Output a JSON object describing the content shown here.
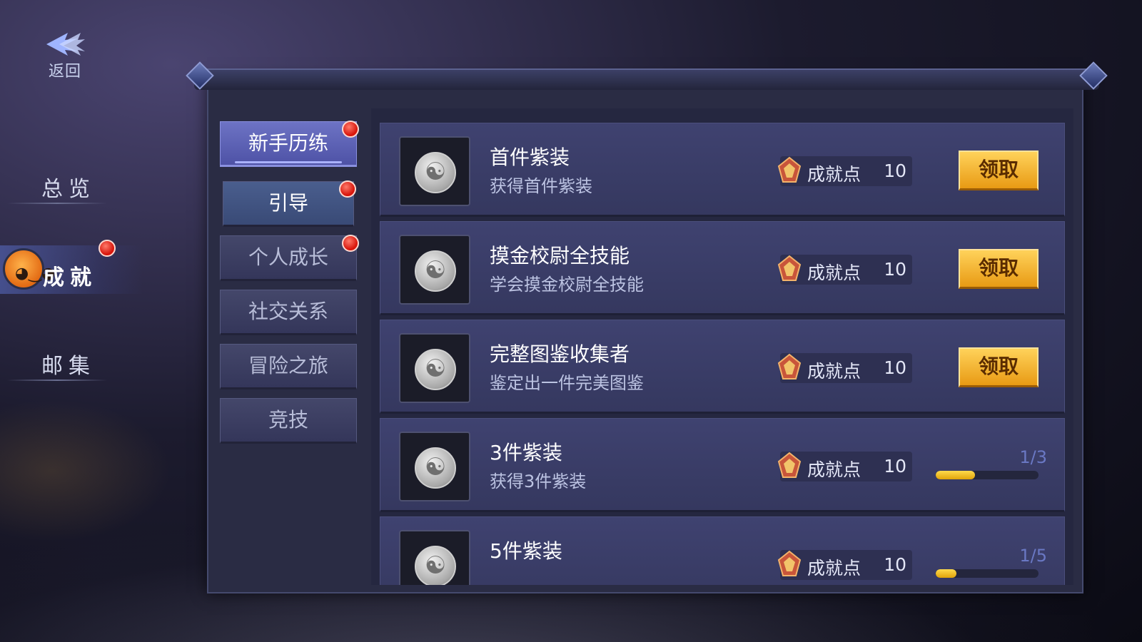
{
  "header": {
    "back_label": "返回"
  },
  "left_nav": [
    {
      "label": "总览",
      "active": false,
      "badge": false
    },
    {
      "label": "成就",
      "active": true,
      "badge": true
    },
    {
      "label": "邮集",
      "active": false,
      "badge": false
    }
  ],
  "categories": [
    {
      "label": "新手历练",
      "active": true,
      "badge": true
    },
    {
      "label": "引导",
      "active": false,
      "badge": true
    },
    {
      "label": "个人成长",
      "active": false,
      "badge": true
    },
    {
      "label": "社交关系",
      "active": false,
      "badge": false
    },
    {
      "label": "冒险之旅",
      "active": false,
      "badge": false
    },
    {
      "label": "竞技",
      "active": false,
      "badge": false
    }
  ],
  "achievements": [
    {
      "title": "首件紫装",
      "desc": "获得首件紫装",
      "points_label": "成就点",
      "points": "10",
      "state": "claim",
      "claim_label": "领取"
    },
    {
      "title": "摸金校尉全技能",
      "desc": "学会摸金校尉全技能",
      "points_label": "成就点",
      "points": "10",
      "state": "claim",
      "claim_label": "领取"
    },
    {
      "title": "完整图鉴收集者",
      "desc": "鉴定出一件完美图鉴",
      "points_label": "成就点",
      "points": "10",
      "state": "claim",
      "claim_label": "领取"
    },
    {
      "title": "3件紫装",
      "desc": "获得3件紫装",
      "points_label": "成就点",
      "points": "10",
      "state": "progress",
      "progress_text": "1/3",
      "progress": 0.38
    },
    {
      "title": "5件紫装",
      "desc": "",
      "points_label": "成就点",
      "points": "10",
      "state": "progress",
      "progress_text": "1/5",
      "progress": 0.2
    }
  ],
  "colors": {
    "claim_button": "#f0b030",
    "progress_fill": "#f5c21f",
    "active_tab": "#5d62b6",
    "notification_dot": "#e8231a"
  },
  "icons": {
    "back": "double-chevron-left-icon",
    "achievement_badge": "yin-yang-coin-icon",
    "points": "medal-icon",
    "nav_avatar": "pumpkin-avatar-icon"
  }
}
